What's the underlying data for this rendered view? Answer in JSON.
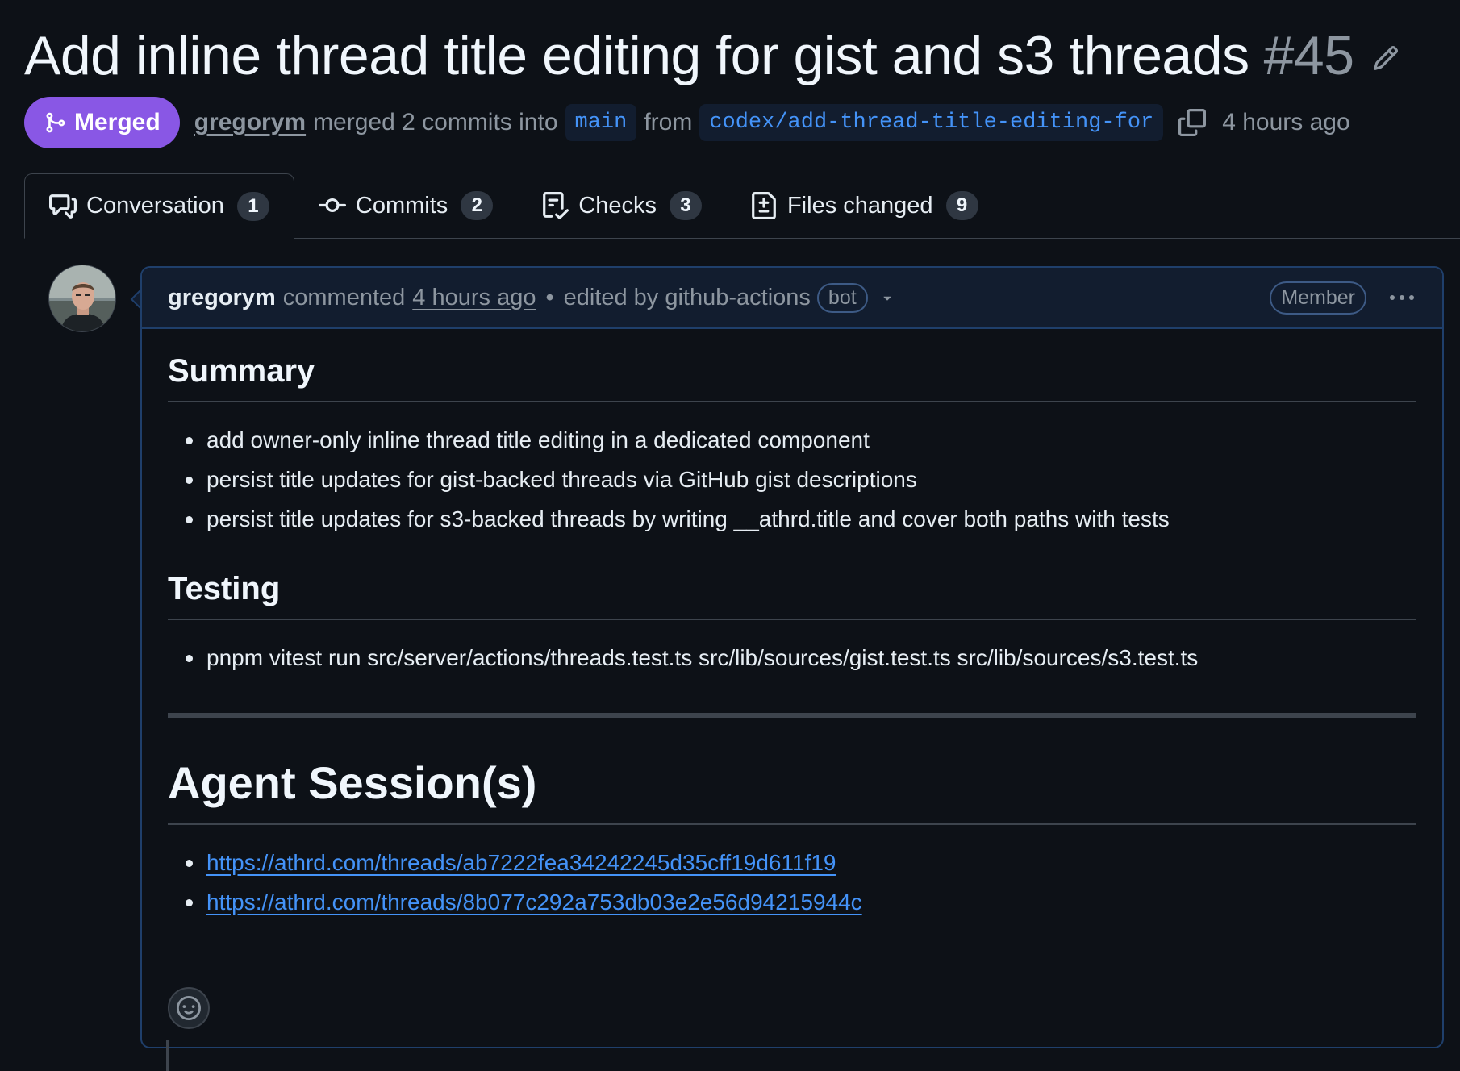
{
  "header": {
    "title": "Add inline thread title editing for gist and s3 threads",
    "number": "#45"
  },
  "meta": {
    "status": "Merged",
    "author": "gregorym",
    "merged_text": "merged 2 commits into",
    "base_branch": "main",
    "from_text": "from",
    "head_branch": "codex/add-thread-title-editing-for",
    "time_ago": "4 hours ago"
  },
  "tabs": [
    {
      "label": "Conversation",
      "count": "1",
      "icon": "comment-discussion-icon"
    },
    {
      "label": "Commits",
      "count": "2",
      "icon": "git-commit-icon"
    },
    {
      "label": "Checks",
      "count": "3",
      "icon": "checklist-icon"
    },
    {
      "label": "Files changed",
      "count": "9",
      "icon": "file-diff-icon"
    }
  ],
  "comment": {
    "author": "gregorym",
    "action": "commented",
    "time": "4 hours ago",
    "dot": "•",
    "edited_text": "edited by github-actions",
    "bot_label": "bot",
    "role_label": "Member",
    "summary_heading": "Summary",
    "summary_items": [
      "add owner-only inline thread title editing in a dedicated component",
      "persist title updates for gist-backed threads via GitHub gist descriptions",
      "persist title updates for s3-backed threads by writing __athrd.title and cover both paths with tests"
    ],
    "testing_heading": "Testing",
    "testing_items": [
      "pnpm vitest run src/server/actions/threads.test.ts src/lib/sources/gist.test.ts src/lib/sources/s3.test.ts"
    ],
    "sessions_heading": "Agent Session(s)",
    "session_links": [
      "https://athrd.com/threads/ab7222fea34242245d35cff19d611f19",
      "https://athrd.com/threads/8b077c292a753db03e2e56d94215944c"
    ]
  },
  "colors": {
    "background": "#0d1117",
    "merged_purple": "#8957e5",
    "link_blue": "#4493f8",
    "muted": "#8d96a0"
  }
}
